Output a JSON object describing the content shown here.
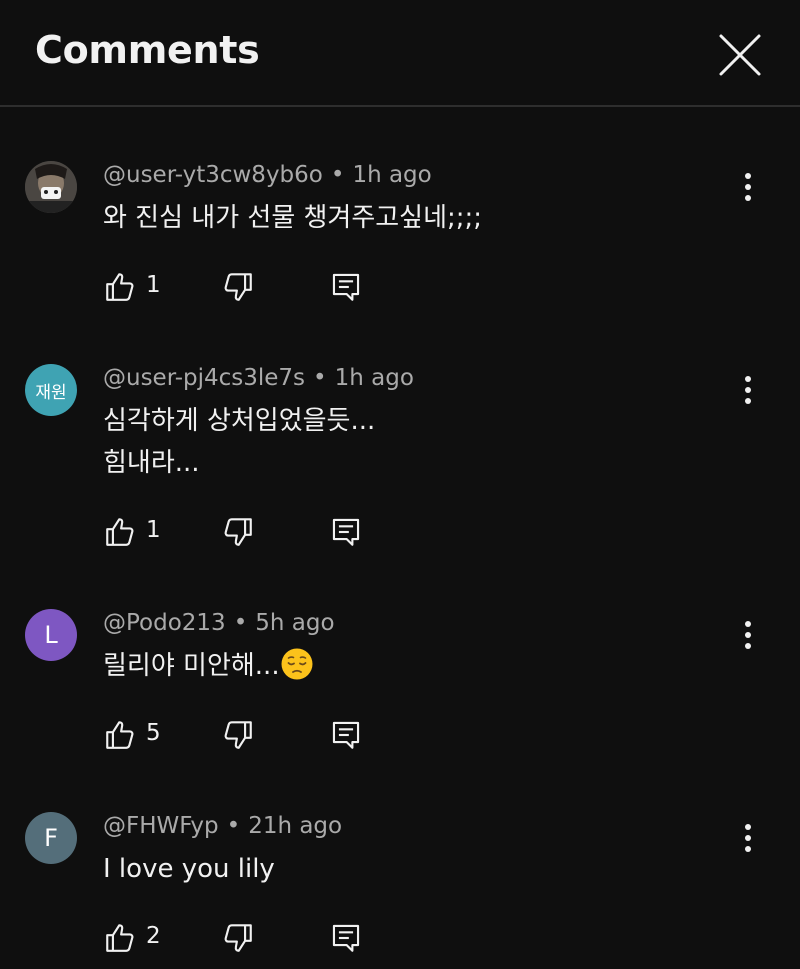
{
  "header": {
    "title": "Comments",
    "close_icon": "close-icon"
  },
  "colors": {
    "background": "#0f0f0f",
    "text_primary": "#f1f1f1",
    "text_secondary": "#aaaaaa",
    "divider": "#2e2e2e",
    "avatar_teal": "#3fa3b3",
    "avatar_purple": "#7e57c2",
    "avatar_slate": "#546e7a"
  },
  "comments": [
    {
      "author": "@user-yt3cw8yb6o",
      "time": "1h ago",
      "lines": [
        "와 진심 내가 선물 챙겨주고싶네;;;;"
      ],
      "likes": "1",
      "avatar": {
        "type": "photo",
        "icon": "user-photo-avatar"
      }
    },
    {
      "author": "@user-pj4cs3le7s",
      "time": "1h ago",
      "lines": [
        "심각하게 상처입었을듯...",
        "힘내라..."
      ],
      "likes": "1",
      "avatar": {
        "type": "text",
        "text": "재원",
        "color": "#3fa3b3"
      }
    },
    {
      "author": "@Podo213",
      "time": "5h ago",
      "lines": [
        "릴리야 미안해..."
      ],
      "emoji": "pensive-face-emoji",
      "likes": "5",
      "avatar": {
        "type": "text",
        "text": "L",
        "color": "#7e57c2"
      }
    },
    {
      "author": "@FHWFyp",
      "time": "21h ago",
      "lines": [
        "I love you lily"
      ],
      "likes": "2",
      "avatar": {
        "type": "text",
        "text": "F",
        "color": "#546e7a"
      }
    }
  ],
  "icons": {
    "like": "thumb-up-icon",
    "dislike": "thumb-down-icon",
    "reply": "reply-comment-icon",
    "more": "more-vertical-icon"
  },
  "meta_separator": "•"
}
